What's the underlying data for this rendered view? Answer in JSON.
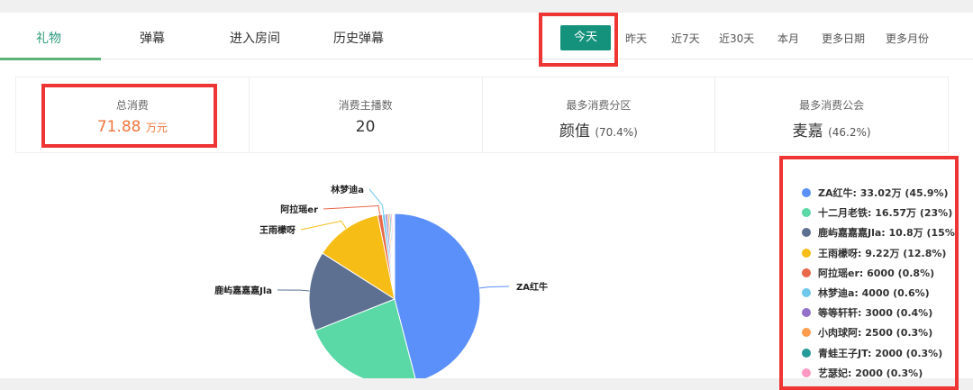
{
  "tabs": [
    {
      "label": "礼物",
      "active": true
    },
    {
      "label": "弹幕"
    },
    {
      "label": "进入房间"
    },
    {
      "label": "历史弹幕"
    }
  ],
  "date_ranges": [
    "今天",
    "昨天",
    "近7天",
    "近30天",
    "本月",
    "更多日期",
    "更多月份"
  ],
  "stats": [
    {
      "label": "总消费",
      "value": "71.88",
      "unit": "万元"
    },
    {
      "label": "消费主播数",
      "value": "20"
    },
    {
      "label": "最多消费分区",
      "value": "颜值",
      "sub": "(70.4%)"
    },
    {
      "label": "最多消费公会",
      "value": "麦嘉",
      "sub": "(46.2%)"
    }
  ],
  "chart_data": {
    "type": "pie",
    "total": 718800,
    "slices": [
      {
        "name": "ZA红牛",
        "value": 330200,
        "legend": "ZA红牛: 33.02万 (45.9%)",
        "color": "#5b8ff9",
        "label": true
      },
      {
        "name": "十二月老铁",
        "value": 165700,
        "legend": "十二月老铁: 16.57万 (23%)",
        "color": "#5ad8a6",
        "label": false
      },
      {
        "name": "鹿屿嘉嘉嘉Jla",
        "value": 108000,
        "legend": "鹿屿嘉嘉嘉Jla: 10.8万 (15%)",
        "color": "#5d7092",
        "label": true
      },
      {
        "name": "王雨檬呀",
        "value": 92200,
        "legend": "王雨檬呀: 9.22万 (12.8%)",
        "color": "#f6bd16",
        "label": true
      },
      {
        "name": "阿拉瑶er",
        "value": 6000,
        "legend": "阿拉瑶er: 6000 (0.8%)",
        "color": "#e8684a",
        "label": true
      },
      {
        "name": "林梦迪a",
        "value": 4000,
        "legend": "林梦迪a: 4000 (0.6%)",
        "color": "#6dc8ec",
        "label": true
      },
      {
        "name": "等等轩轩",
        "value": 3000,
        "legend": "等等轩轩: 3000 (0.4%)",
        "color": "#9270ca",
        "label": false
      },
      {
        "name": "小肉球阿",
        "value": 2500,
        "legend": "小肉球阿: 2500 (0.3%)",
        "color": "#ff9d4d",
        "label": false
      },
      {
        "name": "青蛙王子JT",
        "value": 2000,
        "legend": "青蛙王子JT: 2000 (0.3%)",
        "color": "#269a99",
        "label": false
      },
      {
        "name": "艺瑟妃",
        "value": 2000,
        "legend": "艺瑟妃: 2000 (0.3%)",
        "color": "#ff99c3",
        "label": false
      }
    ]
  }
}
